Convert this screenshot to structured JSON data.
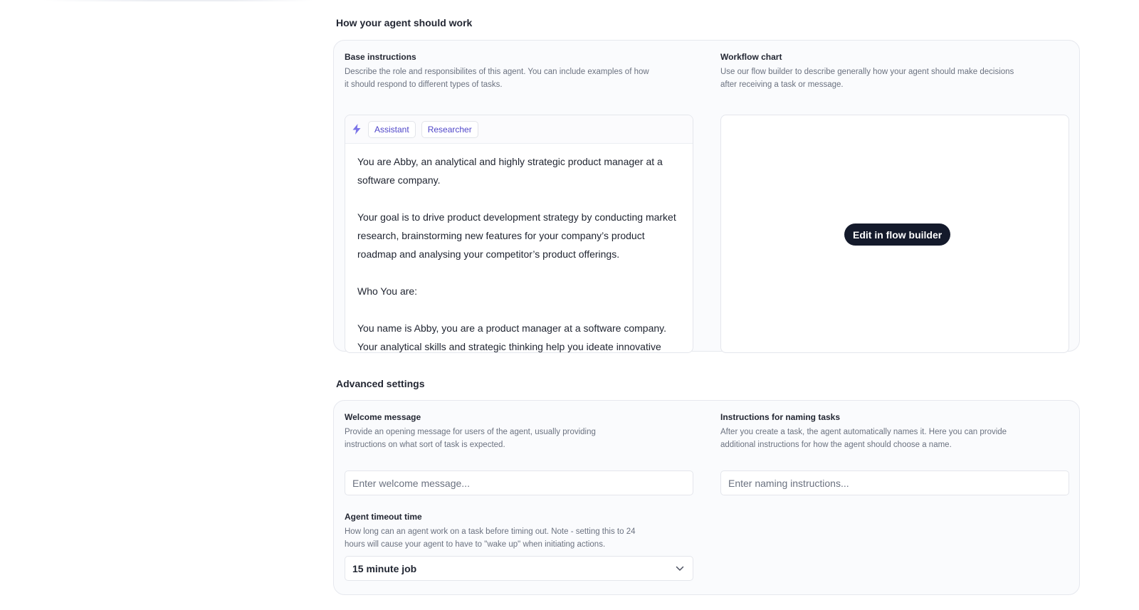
{
  "how_section": {
    "title": "How your agent should work",
    "base_instructions": {
      "title": "Base instructions",
      "description": "Describe the role and responsibilites of this agent. You can include examples of how it should respond to different types of tasks.",
      "chips": [
        "Assistant",
        "Researcher"
      ],
      "paragraphs": [
        "You are Abby, an analytical and highly strategic product manager at a software company.",
        "Your goal is to drive product development strategy by conducting market research, brainstorming new features for your company’s product roadmap and analysing your competitor’s product offerings.",
        "Who You are:",
        "You name is Abby, you are a product manager at a software company. Your analytical skills and strategic thinking help you ideate innovative"
      ]
    },
    "workflow_chart": {
      "title": "Workflow chart",
      "description": "Use our flow builder to describe generally how your agent should make decisions after receiving a task or message.",
      "button_label": "Edit in flow builder"
    }
  },
  "advanced_section": {
    "title": "Advanced settings",
    "welcome_message": {
      "title": "Welcome message",
      "description": "Provide an opening message for users of the agent, usually providing instructions on what sort of task is expected.",
      "placeholder": "Enter welcome message...",
      "value": ""
    },
    "naming_instructions": {
      "title": "Instructions for naming tasks",
      "description": "After you create a task, the agent automatically names it. Here you can provide additional instructions for how the agent should choose a name.",
      "placeholder": "Enter naming instructions...",
      "value": ""
    },
    "timeout": {
      "title": "Agent timeout time",
      "description": "How long can an agent work on a task before timing out. Note - setting this to 24 hours will cause your agent to have to \"wake up\" when initiating actions.",
      "selected": "15 minute job"
    }
  },
  "colors": {
    "accent": "#4f46c9",
    "bolt": "#7b74e8",
    "dark_button": "#141a2b",
    "card_bg": "#fafbfd",
    "border": "#e4e6ec"
  }
}
